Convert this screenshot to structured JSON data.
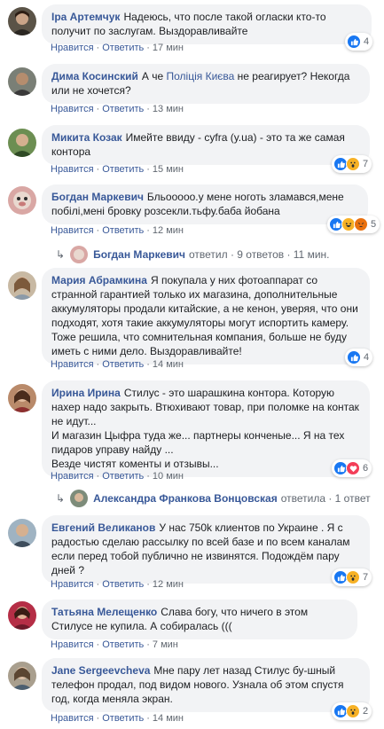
{
  "comments": [
    {
      "author": "Іра Артемчук",
      "text": "Надеюсь, что после такой огласки кто-то получит по заслугам. Выздоравливайте",
      "like": "Нравится",
      "reply": "Ответить",
      "time": "17 мин",
      "reactions": [
        "like"
      ],
      "count": "4"
    },
    {
      "author": "Дима Косинский",
      "text_before": "А че ",
      "mention": "Поліція Києва",
      "text_after": " не реагирует? Некогда или не хочется?",
      "like": "Нравится",
      "reply": "Ответить",
      "time": "13 мин"
    },
    {
      "author": "Микита Козак",
      "text": "Имейте ввиду - cyfra (y.ua) - это та же самая контора",
      "like": "Нравится",
      "reply": "Ответить",
      "time": "15 мин",
      "reactions": [
        "like",
        "wow"
      ],
      "count": "7"
    },
    {
      "author": "Богдан Маркевич",
      "text": "Бльооооо.у мене ноготь зламався,мене побілі,мені бровку розсекли.тьфу.баба йобана",
      "like": "Нравится",
      "reply": "Ответить",
      "time": "12 мин",
      "reactions": [
        "like",
        "haha",
        "angry"
      ],
      "count": "5",
      "replies": {
        "name": "Богдан Маркевич",
        "meta": "ответил · 9 ответов · 11 мин."
      }
    },
    {
      "author": "Мария Абрамкина",
      "text": "Я покупала у них фотоаппарат со странной гарантией только их магазина, дополнительные аккумуляторы продали китайские, а не кенон, уверяя, что они подходят, хотя такие аккумуляторы могут испортить камеру. Тоже решила, что сомнительная компания, больше не буду иметь с ними дело. Выздоравливайте!",
      "like": "Нравится",
      "reply": "Ответить",
      "time": "14 мин",
      "reactions": [
        "like"
      ],
      "count": "4"
    },
    {
      "author": "Ирина Ирина",
      "text": "Стилус - это шарашкина контора. Которую нахер надо закрыть. Втюхивают товар, при поломке на контак не идут...\nИ магазин Цыфра туда же... партнеры конченые... Я на тех пидаров управу найду ...\nВезде чистят коменты и отзывы...",
      "like": "Нравится",
      "reply": "Ответить",
      "time": "10 мин",
      "reactions": [
        "like",
        "love"
      ],
      "count": "6",
      "replies": {
        "name": "Александра Франкова Вонцовская",
        "meta": "ответила · 1 ответ"
      }
    },
    {
      "author": "Евгений Великанов",
      "text": "У нас 750k клиентов по Украине . Я с радостью сделаю рассылку по всей базе и по всем каналам если перед тобой публично не извинятся. Подождём пару дней ?",
      "like": "Нравится",
      "reply": "Ответить",
      "time": "12 мин",
      "reactions": [
        "like",
        "wow"
      ],
      "count": "7"
    },
    {
      "author": "Татьяна Мелещенко",
      "text": "Слава богу, что ничего в этом Стилусе не купила. А собиралась (((",
      "like": "Нравится",
      "reply": "Ответить",
      "time": "7 мин"
    },
    {
      "author": "Jane Sergeevcheva",
      "text": "Мне пару лет назад Стилус бу-шный телефон продал, под видом нового. Узнала об этом спустя год, когда меняла экран.",
      "like": "Нравится",
      "reply": "Ответить",
      "time": "14 мин",
      "reactions": [
        "like",
        "wow"
      ],
      "count": "2"
    }
  ],
  "colors": {
    "link": "#385898",
    "bubble": "#f2f3f5",
    "meta": "#606770",
    "like": "#1877f2",
    "love": "#f33e58",
    "wow": "#f7b125",
    "angry": "#e9710f"
  }
}
